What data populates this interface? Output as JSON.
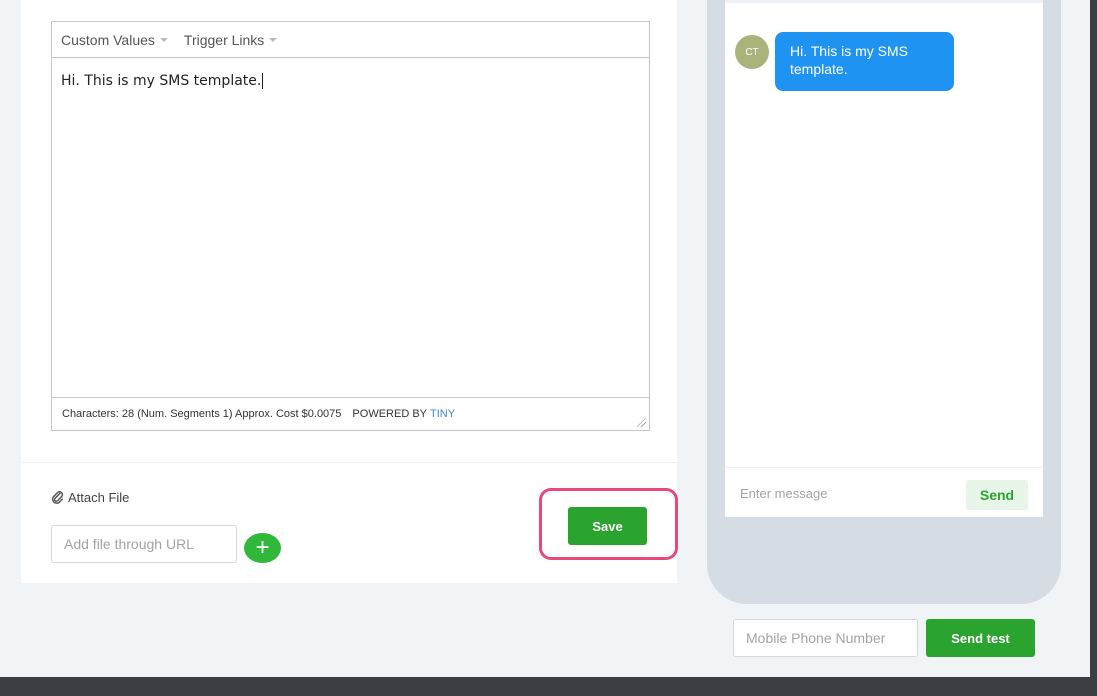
{
  "editor": {
    "menu": {
      "custom_values": "Custom Values",
      "trigger_links": "Trigger Links"
    },
    "content": "Hi. This is my SMS template.",
    "status": {
      "characters_info": "Characters: 28 (Num. Segments 1) Approx. Cost $0.0075",
      "powered_by": "POWERED BY",
      "tiny": "TINY"
    }
  },
  "attachments": {
    "attach_label": "Attach File",
    "url_placeholder": "Add file through URL",
    "add_symbol": "+"
  },
  "actions": {
    "save_label": "Save"
  },
  "preview": {
    "avatar_initials": "CT",
    "message_text": "Hi. This is my SMS template.",
    "message_placeholder": "Enter message",
    "send_label": "Send"
  },
  "test": {
    "phone_placeholder": "Mobile Phone Number",
    "send_test_label": "Send test"
  },
  "colors": {
    "primary_green": "#2aa32f",
    "bubble_blue": "#1f93f2",
    "highlight_pink": "#e6497a",
    "avatar_olive": "#aab47a"
  }
}
